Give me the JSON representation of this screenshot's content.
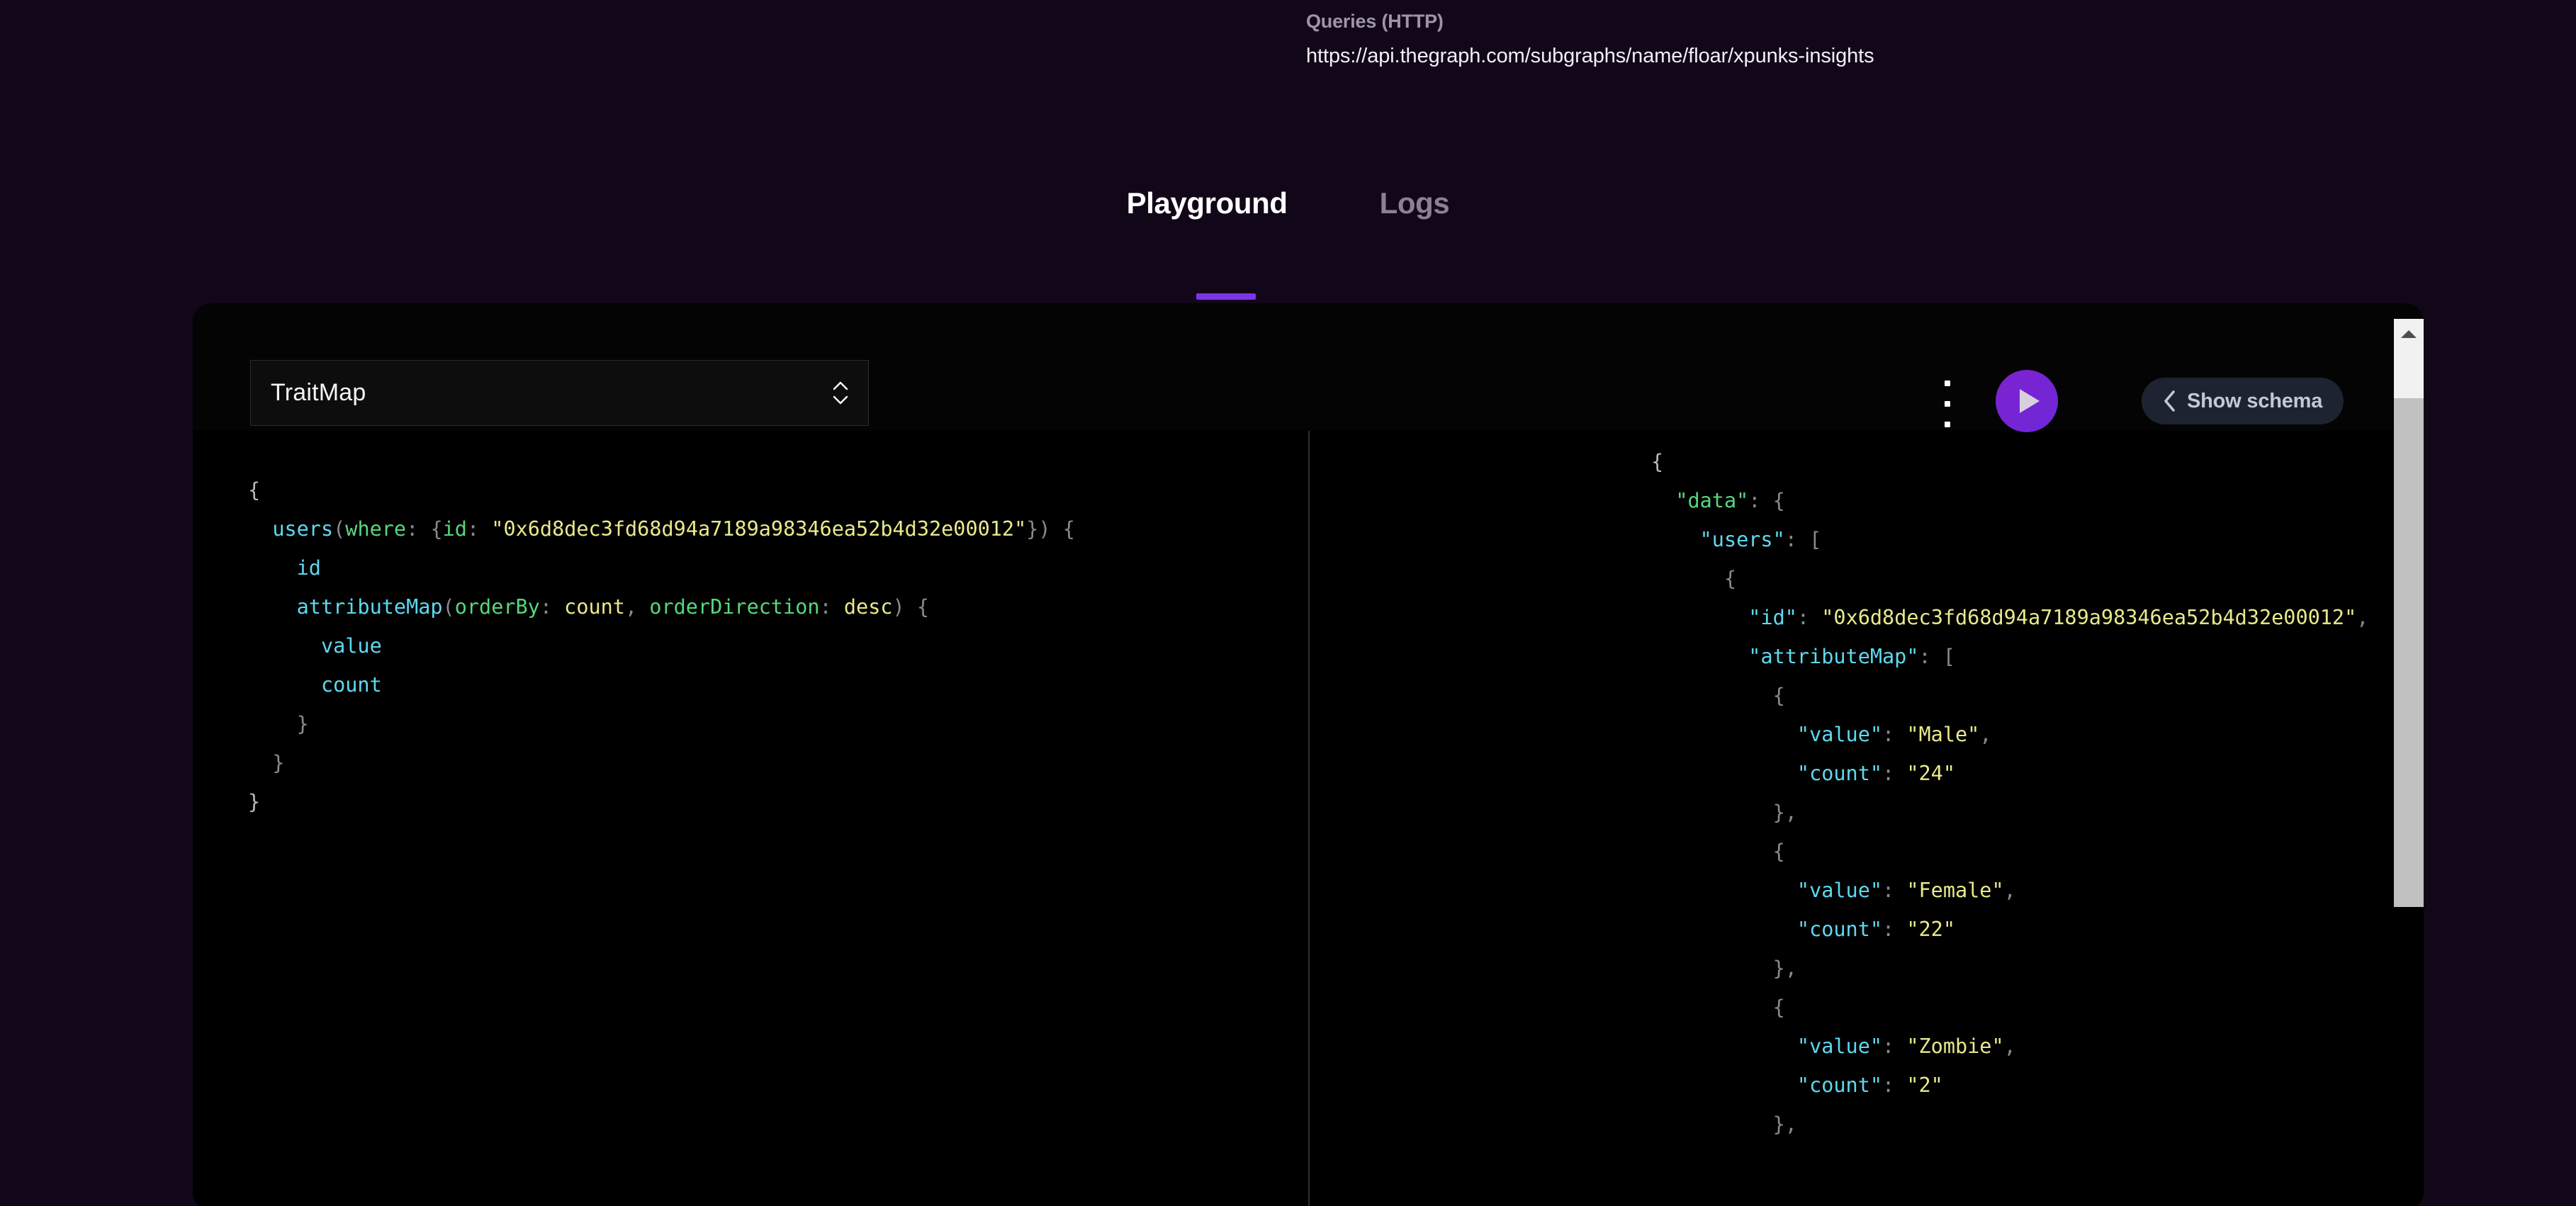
{
  "header": {
    "queries_label": "Queries (HTTP)",
    "endpoint_url": "https://api.thegraph.com/subgraphs/name/floar/xpunks-insights"
  },
  "tabs": [
    {
      "label": "Playground",
      "active": true
    },
    {
      "label": "Logs",
      "active": false
    }
  ],
  "toolbar": {
    "operation_name": "TraitMap",
    "kebab_icon": "kebab-menu-icon",
    "execute_icon": "play-icon",
    "show_schema_label": "Show schema",
    "show_schema_chevron_icon": "chevron-left-icon",
    "select_chevron_up_icon": "chevron-up-icon",
    "select_chevron_down_icon": "chevron-down-icon"
  },
  "query_editor": {
    "language": "graphql",
    "lines": [
      "{",
      "  users(where: {id: \"0x6d8dec3fd68d94a7189a98346ea52b4d32e00012\"}) {",
      "    id",
      "    attributeMap(orderBy: count, orderDirection: desc) {",
      "      value",
      "      count",
      "    }",
      "  }",
      "}"
    ],
    "tokens": {
      "field_color": "#5ed9f0",
      "argument_color": "#57d77d",
      "string_color": "#e8ea8b",
      "punctuation_color": "#8a8a8a"
    }
  },
  "result_viewer": {
    "lines": [
      "{",
      "  \"data\": {",
      "    \"users\": [",
      "      {",
      "        \"id\": \"0x6d8dec3fd68d94a7189a98346ea52b4d32e00012\",",
      "        \"attributeMap\": [",
      "          {",
      "            \"value\": \"Male\",",
      "            \"count\": \"24\"",
      "          },",
      "          {",
      "            \"value\": \"Female\",",
      "            \"count\": \"22\"",
      "          },",
      "          {",
      "            \"value\": \"Zombie\",",
      "            \"count\": \"2\"",
      "          },"
    ],
    "data": {
      "users": [
        {
          "id": "0x6d8dec3fd68d94a7189a98346ea52b4d32e00012",
          "attributeMap": [
            {
              "value": "Male",
              "count": "24"
            },
            {
              "value": "Female",
              "count": "22"
            },
            {
              "value": "Zombie",
              "count": "2"
            }
          ]
        }
      ]
    },
    "scrollbar": {
      "up_arrow_icon": "triangle-up-icon",
      "thumb_color": "#c1c1c1",
      "track_color": "#f1f1f1"
    }
  },
  "colors": {
    "page_background": "#120619",
    "panel_background": "#040404",
    "accent_purple": "#7b34e8",
    "execute_button": "#7e22ce",
    "show_schema_background": "#1e2331"
  }
}
